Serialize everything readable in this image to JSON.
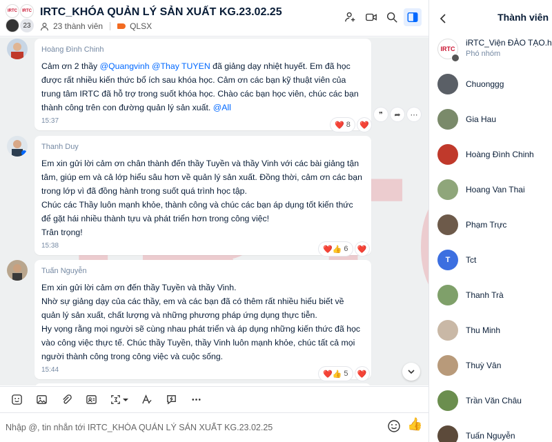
{
  "header": {
    "title": "IRTC_KHÓA QUẢN LÝ SẢN XUẤT KG.23.02.25",
    "members_count": "23 thành viên",
    "tag_label": "QLSX",
    "avatar_count": "23",
    "avatar_logo_text": "IRTC"
  },
  "watermark": "IRTC",
  "messages": [
    {
      "sender": "Hoàng Đình Chinh",
      "text_parts": {
        "p1": "Cảm ơn 2 thầy ",
        "m1": "@Quangvinh",
        "p2": " ",
        "m2": "@Thay TUYEN",
        "p3": " đã giảng dạy nhiệt huyết. Em đã học được rất nhiều kiến thức bổ ích sau khóa học. Cảm ơn các bạn kỹ thuật viên của trung tâm IRTC đã hỗ trợ trong suốt khóa học. Chào các bạn học viên, chúc các bạn thành công trên con đường quản lý sản xuất. ",
        "m3": "@All"
      },
      "time": "15:37",
      "reaction_count": "8",
      "reaction_icons": "❤️",
      "my_reaction": "❤️"
    },
    {
      "sender": "Thanh Duy",
      "text": "Em xin gửi lời cảm ơn chân thành đến thầy Tuyền và thầy Vinh với các bài giảng tận tâm, giúp em và cả lớp hiểu sâu hơn về quản lý sản xuất. Đồng thời, cảm ơn các bạn trong lớp vì đã đồng hành trong suốt quá trình học tập.\nChúc các Thầy luôn mạnh khỏe, thành công và chúc các bạn áp dụng tốt kiến thức để gặt hái nhiều thành tựu và phát triển hơn trong công việc!\nTrân trọng!",
      "time": "15:38",
      "reaction_count": "6",
      "reaction_icons": "❤️👍",
      "my_reaction": "❤️"
    },
    {
      "sender": "Tuấn Nguyễn",
      "text": "Em xin gửi lời cảm ơn đến thầy Tuyền và thầy Vinh.\nNhờ sự giảng dạy của các thầy, em và các bạn đã có thêm rất nhiều hiểu biết về quản lý sản xuất, chất lượng và những phương pháp ứng dụng thực tiễn.\nHy vọng rằng mọi người sẽ cùng nhau phát triển và áp dụng những kiến thức đã học vào công việc thực tế. Chúc thầy Tuyền, thầy Vinh luôn mạnh khỏe, chúc tất cả mọi người thành công trong công việc và cuộc sống.",
      "time": "15:44",
      "reaction_count": "5",
      "reaction_icons": "❤️👍",
      "my_reaction": "❤️"
    }
  ],
  "message_actions": [
    "quote-icon",
    "forward-icon",
    "more-icon"
  ],
  "toolbar": [
    "sticker-icon",
    "image-icon",
    "attach-icon",
    "contact-card-icon",
    "screenshot-icon",
    "format-text-icon",
    "quick-message-icon",
    "more-icon"
  ],
  "composer": {
    "placeholder": "Nhập @, tin nhắn tới IRTC_KHÓA QUẢN LÝ SẢN XUẤT KG.23.02.25",
    "like_icon": "👍"
  },
  "panel": {
    "title": "Thành viên",
    "members": [
      {
        "name": "iRTC_Viện ĐÀO TẠO.h",
        "role": "Phó nhóm",
        "avatar": "IRTC",
        "color": "#ffffff"
      },
      {
        "name": "Chuonggg",
        "role": "",
        "avatar": "",
        "color": "#5a5f66"
      },
      {
        "name": "Gia Hau",
        "role": "",
        "avatar": "",
        "color": "#7a8a6a"
      },
      {
        "name": "Hoàng Đình Chinh",
        "role": "",
        "avatar": "",
        "color": "#c0392b"
      },
      {
        "name": "Hoang Van Thai",
        "role": "",
        "avatar": "",
        "color": "#8fa67a"
      },
      {
        "name": "Phạm Trực",
        "role": "",
        "avatar": "",
        "color": "#6d5a4a"
      },
      {
        "name": "Tct",
        "role": "",
        "avatar": "T",
        "color": "#3c6fe0"
      },
      {
        "name": "Thanh Trà",
        "role": "",
        "avatar": "",
        "color": "#7fa06a"
      },
      {
        "name": "Thu Minh",
        "role": "",
        "avatar": "",
        "color": "#c9b8a6"
      },
      {
        "name": "Thuỳ Vân",
        "role": "",
        "avatar": "",
        "color": "#b89a7a"
      },
      {
        "name": "Trần Văn Châu",
        "role": "",
        "avatar": "",
        "color": "#6b8e4e"
      },
      {
        "name": "Tuấn Nguyễn",
        "role": "",
        "avatar": "",
        "color": "#5c4a3a"
      }
    ]
  }
}
